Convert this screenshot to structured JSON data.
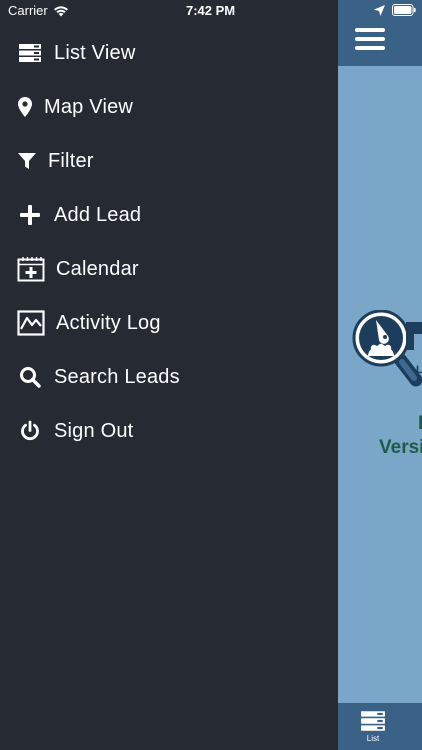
{
  "status": {
    "carrier": "Carrier",
    "time": "7:42 PM"
  },
  "menu": {
    "items": [
      {
        "label": "List View",
        "icon": "list-view-icon"
      },
      {
        "label": "Map View",
        "icon": "map-pin-icon"
      },
      {
        "label": "Filter",
        "icon": "filter-icon"
      },
      {
        "label": "Add Lead",
        "icon": "plus-icon"
      },
      {
        "label": "Calendar",
        "icon": "calendar-icon"
      },
      {
        "label": "Activity Log",
        "icon": "activity-chart-icon"
      },
      {
        "label": "Search Leads",
        "icon": "search-icon"
      },
      {
        "label": "Sign Out",
        "icon": "power-icon"
      }
    ]
  },
  "main": {
    "logo_letter": "L",
    "brand_line1": "L",
    "brand_line2": "Versi"
  },
  "tabbar": {
    "list_label": "List"
  },
  "colors": {
    "drawer_bg": "#252a33",
    "header_bg": "#3a6287",
    "content_bg": "#7aa6c8",
    "brand_green": "#1e5c4a"
  }
}
